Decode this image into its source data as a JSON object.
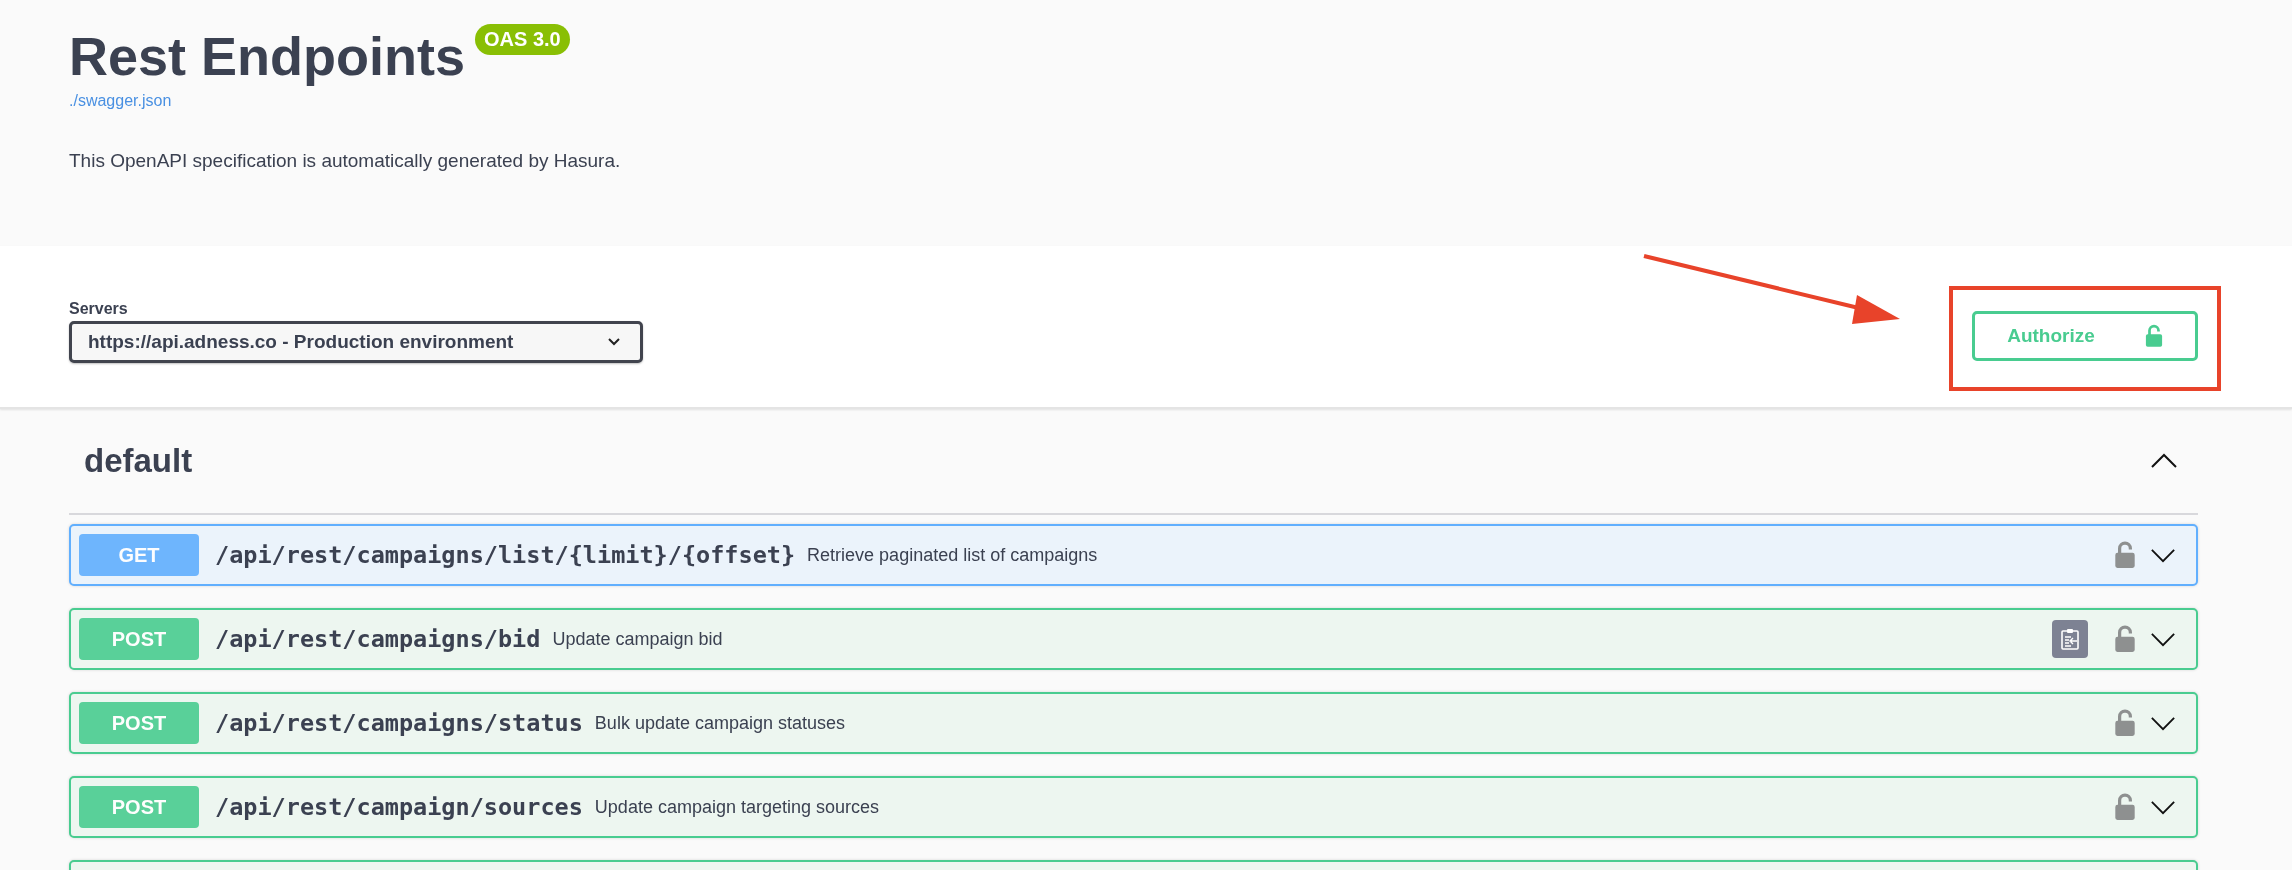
{
  "info": {
    "title": "Rest Endpoints",
    "version_badge": "OAS 3.0",
    "spec_link": "./swagger.json",
    "description": "This OpenAPI specification is automatically generated by Hasura."
  },
  "servers": {
    "label": "Servers",
    "value": "https://api.adness.co - Production environment"
  },
  "authorize": {
    "label": "Authorize"
  },
  "section": {
    "name": "default",
    "expanded": true,
    "operations": [
      {
        "kind": "get",
        "method": "GET",
        "path": "/api/rest/campaigns/list/{limit}/{offset}",
        "summary": "Retrieve paginated list of campaigns",
        "copy_button": false,
        "expanded": false
      },
      {
        "kind": "post",
        "method": "POST",
        "path": "/api/rest/campaigns/bid",
        "summary": "Update campaign bid",
        "copy_button": true,
        "expanded": false
      },
      {
        "kind": "post",
        "method": "POST",
        "path": "/api/rest/campaigns/status",
        "summary": "Bulk update campaign statuses",
        "copy_button": false,
        "expanded": false
      },
      {
        "kind": "post",
        "method": "POST",
        "path": "/api/rest/campaign/sources",
        "summary": "Update campaign targeting sources",
        "copy_button": false,
        "expanded": false
      }
    ]
  }
}
